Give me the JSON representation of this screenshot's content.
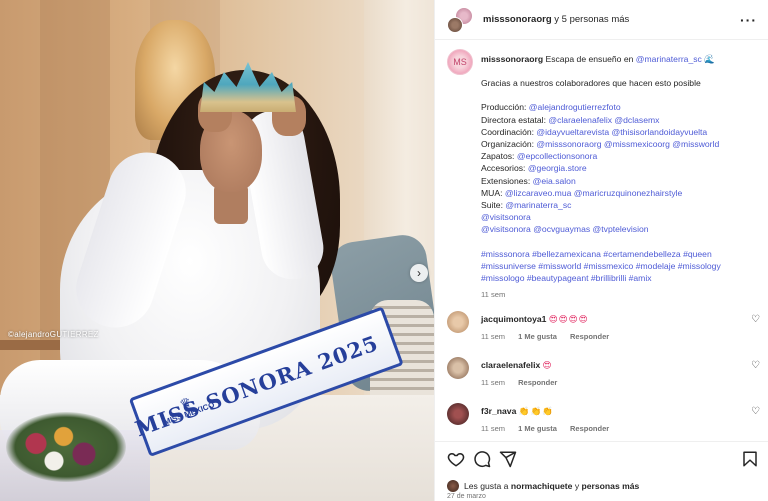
{
  "photo": {
    "watermark": "©alejandroGUTIERREZ",
    "sash_text": "MISS SONORA 2025",
    "sash_logo_text": "MISS MÉXICO",
    "next_icon": "chevron-right-icon"
  },
  "header": {
    "username": "misssonoraorg",
    "suffix": "y 5 personas más",
    "more_icon": "more-horizontal-icon"
  },
  "caption": {
    "avatar_text": "MS",
    "username": "misssonoraorg",
    "line1_text": "Escapa de ensueño en",
    "line1_mention": "@marinaterra_sc",
    "line1_emoji": "🌊",
    "thanks": "Gracias a nuestros colaboradores que hacen esto posible",
    "credits": [
      {
        "label": "Producción:",
        "mentions": "@alejandrogutierrezfoto"
      },
      {
        "label": "Directora estatal:",
        "mentions": "@claraelenafelix @dclasemx"
      },
      {
        "label": "Coordinación:",
        "mentions": "@idayvueltarevista @thisisorlandoidayvuelta"
      },
      {
        "label": "Organización:",
        "mentions": "@misssonoraorg @missmexicoorg @missworld"
      },
      {
        "label": "Zapatos:",
        "mentions": "@epcollectionsonora"
      },
      {
        "label": "Accesorios:",
        "mentions": "@georgia.store"
      },
      {
        "label": "Extensiones:",
        "mentions": "@eia.salon"
      },
      {
        "label": "MUA:",
        "mentions": "@lizcaraveo.mua @maricruzquinonezhairstyle"
      },
      {
        "label": "Suite:",
        "mentions": "@marinaterra_sc"
      },
      {
        "label": "",
        "mentions": "@visitsonora"
      },
      {
        "label": "",
        "mentions": "@visitsonora @ocvguaymas @tvptelevision"
      }
    ],
    "hashtags": "#misssonora #bellezamexicana #certamendebelleza #queen #missuniverse #missworld #missmexico #modelaje #missology #missologo #beautypageant #brillibrilli #amix",
    "time": "11 sem"
  },
  "comments": [
    {
      "username": "jacquimontoya1",
      "emoji": "😍😍😍😍",
      "time": "11 sem",
      "likes": "1 Me gusta",
      "reply": "Responder",
      "heart_icon": "heart-outline-icon"
    },
    {
      "username": "claraelenafelix",
      "emoji": "😍",
      "time": "11 sem",
      "likes": "",
      "reply": "Responder",
      "heart_icon": "heart-outline-icon"
    },
    {
      "username": "f3r_nava",
      "emoji": "👏👏👏",
      "time": "11 sem",
      "likes": "1 Me gusta",
      "reply": "Responder",
      "heart_icon": "heart-outline-icon"
    }
  ],
  "actions": {
    "like_icon": "heart-icon",
    "comment_icon": "comment-icon",
    "share_icon": "send-icon",
    "save_icon": "bookmark-icon",
    "likes_prefix": "Les gusta a",
    "likes_user": "normachiquete",
    "likes_and": "y",
    "likes_others": "personas más",
    "date": "27 de marzo"
  }
}
